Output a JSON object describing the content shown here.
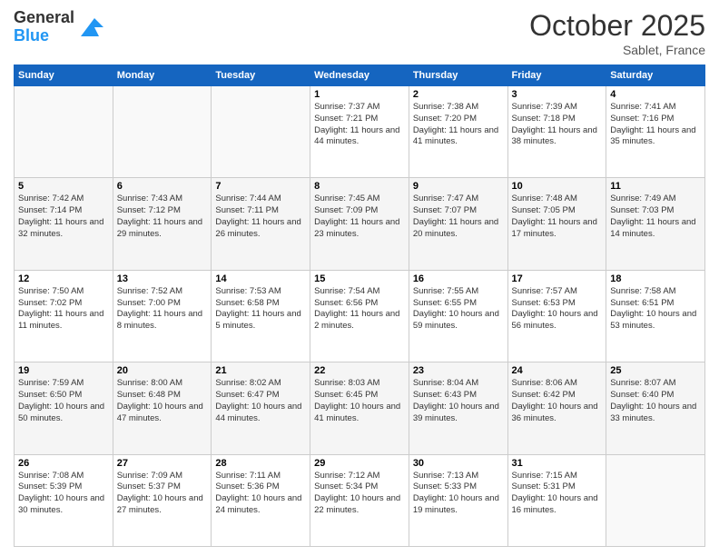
{
  "header": {
    "logo_general": "General",
    "logo_blue": "Blue",
    "month_title": "October 2025",
    "subtitle": "Sablet, France"
  },
  "days_of_week": [
    "Sunday",
    "Monday",
    "Tuesday",
    "Wednesday",
    "Thursday",
    "Friday",
    "Saturday"
  ],
  "weeks": [
    [
      {
        "day": "",
        "info": ""
      },
      {
        "day": "",
        "info": ""
      },
      {
        "day": "",
        "info": ""
      },
      {
        "day": "1",
        "info": "Sunrise: 7:37 AM\nSunset: 7:21 PM\nDaylight: 11 hours and 44 minutes."
      },
      {
        "day": "2",
        "info": "Sunrise: 7:38 AM\nSunset: 7:20 PM\nDaylight: 11 hours and 41 minutes."
      },
      {
        "day": "3",
        "info": "Sunrise: 7:39 AM\nSunset: 7:18 PM\nDaylight: 11 hours and 38 minutes."
      },
      {
        "day": "4",
        "info": "Sunrise: 7:41 AM\nSunset: 7:16 PM\nDaylight: 11 hours and 35 minutes."
      }
    ],
    [
      {
        "day": "5",
        "info": "Sunrise: 7:42 AM\nSunset: 7:14 PM\nDaylight: 11 hours and 32 minutes."
      },
      {
        "day": "6",
        "info": "Sunrise: 7:43 AM\nSunset: 7:12 PM\nDaylight: 11 hours and 29 minutes."
      },
      {
        "day": "7",
        "info": "Sunrise: 7:44 AM\nSunset: 7:11 PM\nDaylight: 11 hours and 26 minutes."
      },
      {
        "day": "8",
        "info": "Sunrise: 7:45 AM\nSunset: 7:09 PM\nDaylight: 11 hours and 23 minutes."
      },
      {
        "day": "9",
        "info": "Sunrise: 7:47 AM\nSunset: 7:07 PM\nDaylight: 11 hours and 20 minutes."
      },
      {
        "day": "10",
        "info": "Sunrise: 7:48 AM\nSunset: 7:05 PM\nDaylight: 11 hours and 17 minutes."
      },
      {
        "day": "11",
        "info": "Sunrise: 7:49 AM\nSunset: 7:03 PM\nDaylight: 11 hours and 14 minutes."
      }
    ],
    [
      {
        "day": "12",
        "info": "Sunrise: 7:50 AM\nSunset: 7:02 PM\nDaylight: 11 hours and 11 minutes."
      },
      {
        "day": "13",
        "info": "Sunrise: 7:52 AM\nSunset: 7:00 PM\nDaylight: 11 hours and 8 minutes."
      },
      {
        "day": "14",
        "info": "Sunrise: 7:53 AM\nSunset: 6:58 PM\nDaylight: 11 hours and 5 minutes."
      },
      {
        "day": "15",
        "info": "Sunrise: 7:54 AM\nSunset: 6:56 PM\nDaylight: 11 hours and 2 minutes."
      },
      {
        "day": "16",
        "info": "Sunrise: 7:55 AM\nSunset: 6:55 PM\nDaylight: 10 hours and 59 minutes."
      },
      {
        "day": "17",
        "info": "Sunrise: 7:57 AM\nSunset: 6:53 PM\nDaylight: 10 hours and 56 minutes."
      },
      {
        "day": "18",
        "info": "Sunrise: 7:58 AM\nSunset: 6:51 PM\nDaylight: 10 hours and 53 minutes."
      }
    ],
    [
      {
        "day": "19",
        "info": "Sunrise: 7:59 AM\nSunset: 6:50 PM\nDaylight: 10 hours and 50 minutes."
      },
      {
        "day": "20",
        "info": "Sunrise: 8:00 AM\nSunset: 6:48 PM\nDaylight: 10 hours and 47 minutes."
      },
      {
        "day": "21",
        "info": "Sunrise: 8:02 AM\nSunset: 6:47 PM\nDaylight: 10 hours and 44 minutes."
      },
      {
        "day": "22",
        "info": "Sunrise: 8:03 AM\nSunset: 6:45 PM\nDaylight: 10 hours and 41 minutes."
      },
      {
        "day": "23",
        "info": "Sunrise: 8:04 AM\nSunset: 6:43 PM\nDaylight: 10 hours and 39 minutes."
      },
      {
        "day": "24",
        "info": "Sunrise: 8:06 AM\nSunset: 6:42 PM\nDaylight: 10 hours and 36 minutes."
      },
      {
        "day": "25",
        "info": "Sunrise: 8:07 AM\nSunset: 6:40 PM\nDaylight: 10 hours and 33 minutes."
      }
    ],
    [
      {
        "day": "26",
        "info": "Sunrise: 7:08 AM\nSunset: 5:39 PM\nDaylight: 10 hours and 30 minutes."
      },
      {
        "day": "27",
        "info": "Sunrise: 7:09 AM\nSunset: 5:37 PM\nDaylight: 10 hours and 27 minutes."
      },
      {
        "day": "28",
        "info": "Sunrise: 7:11 AM\nSunset: 5:36 PM\nDaylight: 10 hours and 24 minutes."
      },
      {
        "day": "29",
        "info": "Sunrise: 7:12 AM\nSunset: 5:34 PM\nDaylight: 10 hours and 22 minutes."
      },
      {
        "day": "30",
        "info": "Sunrise: 7:13 AM\nSunset: 5:33 PM\nDaylight: 10 hours and 19 minutes."
      },
      {
        "day": "31",
        "info": "Sunrise: 7:15 AM\nSunset: 5:31 PM\nDaylight: 10 hours and 16 minutes."
      },
      {
        "day": "",
        "info": ""
      }
    ]
  ]
}
